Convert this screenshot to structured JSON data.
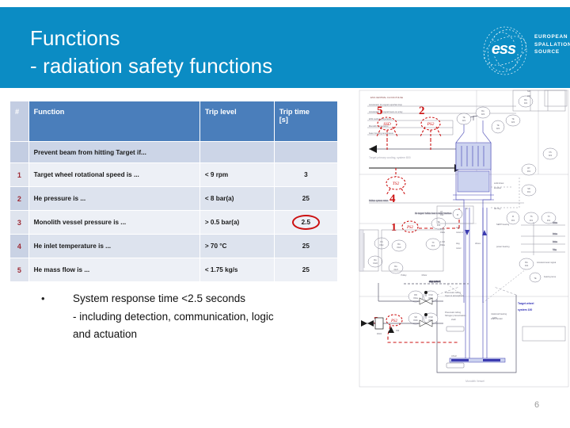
{
  "header": {
    "title_line1": "Functions",
    "title_line2": "- radiation safety functions",
    "band_color": "#0b8cc4",
    "logo": {
      "mark_text": "ess",
      "line1": "EUROPEAN",
      "line2": "SPALLATION",
      "line3": "SOURCE"
    }
  },
  "table": {
    "columns": [
      "#",
      "Function",
      "Trip level",
      "Trip time [s]"
    ],
    "col_num": "#",
    "col_function": "Function",
    "col_trip_level": "Trip level",
    "col_trip_time_l1": "Trip time",
    "col_trip_time_l2": "[s]",
    "subheader": {
      "num": "",
      "function": "Prevent beam from hitting Target if...",
      "trip_level": "",
      "trip_time": ""
    },
    "rows": [
      {
        "num": "1",
        "function": "Target wheel rotational speed is ...",
        "trip_level": "< 9 rpm",
        "trip_time": "3",
        "circled": false
      },
      {
        "num": "2",
        "function": "He pressure is ...",
        "trip_level": "< 8 bar(a)",
        "trip_time": "25",
        "circled": false
      },
      {
        "num": "3",
        "function": "Monolith vessel pressure is ...",
        "trip_level": "> 0.5 bar(a)",
        "trip_time": "2.5",
        "circled": true
      },
      {
        "num": "4",
        "function": "He inlet temperature is ...",
        "trip_level": "> 70 °C",
        "trip_time": "25",
        "circled": false
      },
      {
        "num": "5",
        "function": "He mass flow is ...",
        "trip_level": "< 1.75 kg/s",
        "trip_time": "25",
        "circled": false
      }
    ],
    "header_bg": "#4a7ebb",
    "num_col_bg": "#c3cde2",
    "circle_color": "#cc1111"
  },
  "bullet": {
    "marker": "•",
    "line1": "System response time <2.5 seconds",
    "line2": "- including detection, communication, logic",
    "line3": "and actuation"
  },
  "footer": {
    "page_number": "6"
  },
  "diagram": {
    "caption_top": "ESS CENTRAL CLOCK PULSE",
    "label_target_wheel_l1": "Target wheel",
    "label_target_wheel_l2": "system 100",
    "label_monolith": "Monolith Vessel",
    "label_pressure": "1.1MPa",
    "label_shaft": "shaft",
    "label_wheel": "wheel",
    "label_10pa": "10Pa",
    "annotations": [
      {
        "id": "1",
        "tag": "PS2"
      },
      {
        "id": "2",
        "tag": "PS2"
      },
      {
        "id": "3",
        "tag": "PS2"
      },
      {
        "id": "4",
        "tag": "TS2"
      },
      {
        "id": "5",
        "tag": "SSD"
      }
    ],
    "tags": [
      "BA 022",
      "BA 023",
      "TE 021",
      "TE 023",
      "TE 022",
      "XS 022",
      "RT 301",
      "SR 301",
      "M 301",
      "TS 301",
      "TX 301",
      "TE 013",
      "TX 013",
      "KA 011c",
      "BA 012c",
      "BA 012d",
      "BA 012f",
      "RR 034a",
      "PSD 034a",
      "SR 034b",
      "CSD 034b",
      "F 034"
    ]
  }
}
